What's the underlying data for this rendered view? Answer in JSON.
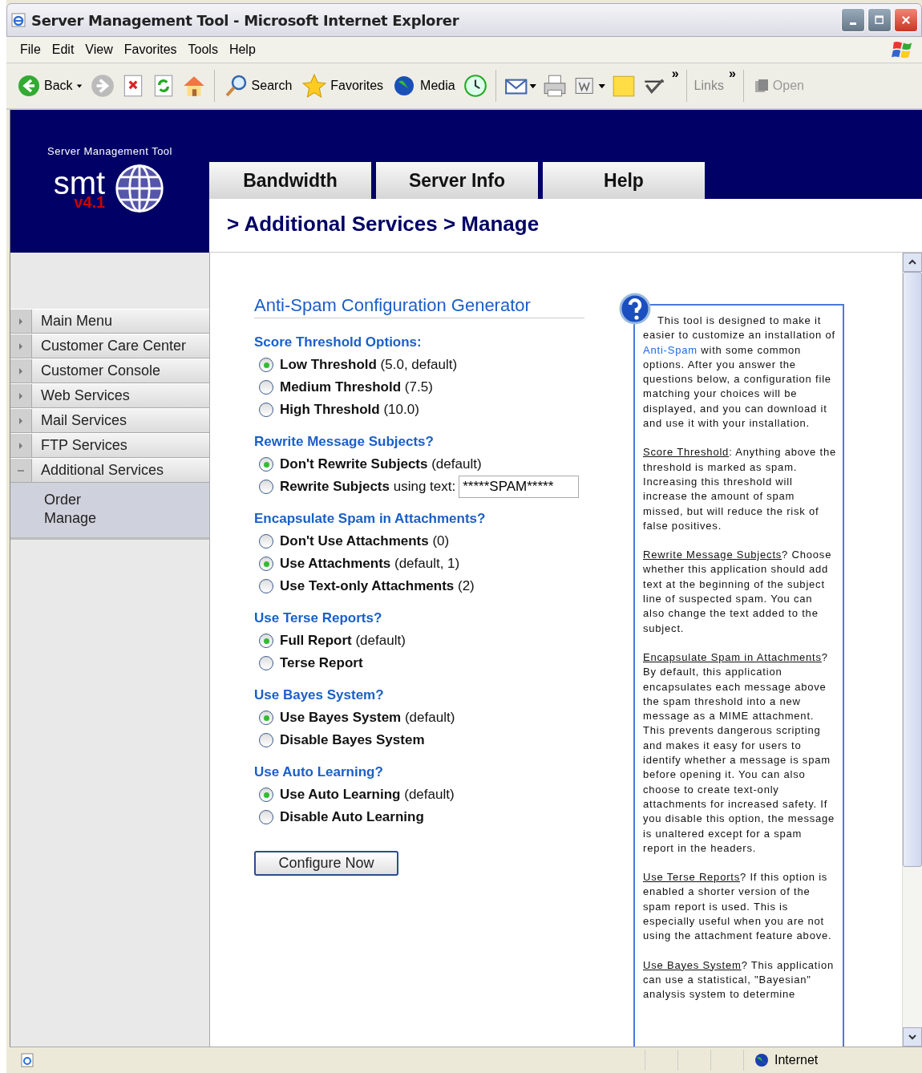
{
  "window": {
    "title": "Server Management Tool - Microsoft Internet Explorer"
  },
  "menu": [
    "File",
    "Edit",
    "View",
    "Favorites",
    "Tools",
    "Help"
  ],
  "toolbar": {
    "back": "Back",
    "search": "Search",
    "favorites": "Favorites",
    "media": "Media",
    "chevron": "»",
    "links": "Links",
    "chevron_2": "»",
    "open": "Open"
  },
  "header": {
    "tagline": "Server Management Tool",
    "logo": "smt",
    "version": "v4.1"
  },
  "tabs": [
    "Bandwidth",
    "Server Info",
    "Help"
  ],
  "breadcrumb": "> Additional Services > Manage",
  "sidebar": {
    "items": [
      {
        "label": "Main Menu",
        "expanded": false
      },
      {
        "label": "Customer Care Center",
        "expanded": false
      },
      {
        "label": "Customer Console",
        "expanded": false
      },
      {
        "label": "Web Services",
        "expanded": false
      },
      {
        "label": "Mail Services",
        "expanded": false
      },
      {
        "label": "FTP Services",
        "expanded": false
      },
      {
        "label": "Additional Services",
        "expanded": true,
        "children": [
          {
            "label": "Order"
          },
          {
            "label": "Manage"
          }
        ]
      }
    ]
  },
  "form": {
    "title": "Anti-Spam Configuration Generator",
    "sections": [
      {
        "title": "Score Threshold Options:",
        "options": [
          {
            "kind": "plain",
            "bold": "Low Threshold",
            "note": "(5.0, default)",
            "selected": true
          },
          {
            "kind": "plain",
            "bold": "Medium Threshold",
            "note": "(7.5)",
            "selected": false
          },
          {
            "kind": "plain",
            "bold": "High Threshold",
            "note": "(10.0)",
            "selected": false
          }
        ]
      },
      {
        "title": "Rewrite Message Subjects?",
        "options": [
          {
            "kind": "plain",
            "bold": "Don't Rewrite Subjects",
            "note": "(default)",
            "selected": true
          },
          {
            "kind": "with-field",
            "bold": "Rewrite Subjects",
            "note": "using text:",
            "field_value": "*****SPAM*****",
            "selected": false
          }
        ]
      },
      {
        "title": "Encapsulate Spam in Attachments?",
        "options": [
          {
            "kind": "plain",
            "bold": "Don't Use Attachments",
            "note": "(0)",
            "selected": false
          },
          {
            "kind": "plain",
            "bold": "Use Attachments",
            "note": "(default, 1)",
            "selected": true
          },
          {
            "kind": "plain",
            "bold": "Use Text-only Attachments",
            "note": "(2)",
            "selected": false
          }
        ]
      },
      {
        "title": "Use Terse Reports?",
        "options": [
          {
            "kind": "plain",
            "bold": "Full Report",
            "note": "(default)",
            "selected": true
          },
          {
            "kind": "plain",
            "bold": "Terse Report",
            "selected": false
          }
        ]
      },
      {
        "title": "Use Bayes System?",
        "options": [
          {
            "kind": "plain",
            "bold": "Use Bayes System",
            "note": "(default)",
            "selected": true
          },
          {
            "kind": "plain",
            "bold": "Disable Bayes System",
            "selected": false
          }
        ]
      },
      {
        "title": "Use Auto Learning?",
        "options": [
          {
            "kind": "plain",
            "bold": "Use Auto Learning",
            "note": "(default)",
            "selected": true
          },
          {
            "kind": "plain",
            "bold": "Disable Auto Learning",
            "selected": false
          }
        ]
      }
    ],
    "button": "Configure Now"
  },
  "help": {
    "intro": {
      "before": "This tool is designed to make it easier to customize an installation of ",
      "link": "Anti-Spam",
      "after": " with some common options. After you answer the questions below, a configuration file matching your choices will be displayed, and you can download it and use it with your installation."
    },
    "paragraphs": [
      {
        "term": "Score Threshold",
        "text": ": Anything above the threshold is marked as spam. Increasing this threshold will increase the amount of spam missed, but will reduce the risk of false positives."
      },
      {
        "term": "Rewrite Message Subjects",
        "text": "? Choose whether this application should add text at the beginning of the subject line of suspected spam. You can also change the text added to the subject."
      },
      {
        "term": "Encapsulate Spam in Attachments",
        "text": "? By default, this application encapsulates each message above the spam threshold into a new message as a MIME attachment. This prevents dangerous scripting and makes it easy for users to identify whether a message is spam before opening it. You can also choose to create text-only attachments for increased safety. If you disable this option, the message is unaltered except for a spam report in the headers."
      },
      {
        "term": "Use Terse Reports",
        "text": "? If this option is enabled a shorter version of the spam report is used. This is especially useful when you are not using the attachment feature above."
      },
      {
        "term": "Use Bayes System",
        "text": "? This application can use a statistical, \"Bayesian\" analysis system to determine"
      }
    ]
  },
  "status_bar": {
    "zone": "Internet"
  }
}
